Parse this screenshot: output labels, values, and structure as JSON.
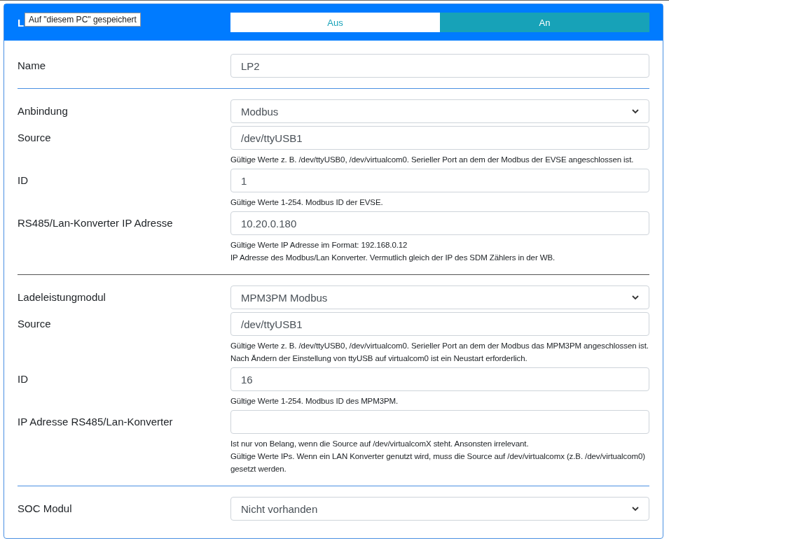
{
  "header": {
    "title": "L",
    "toggle": [
      {
        "label": "Aus",
        "selected": false
      },
      {
        "label": "An",
        "selected": true
      }
    ]
  },
  "tooltip": "Auf \"diesem PC\" gespeichert",
  "rows": [
    {
      "kind": "input",
      "label": "Name",
      "value": "LP2"
    },
    {
      "kind": "divider"
    },
    {
      "kind": "select",
      "label": "Anbindung",
      "value": "Modbus"
    },
    {
      "kind": "input",
      "label": "Source",
      "value": "/dev/ttyUSB1",
      "help": [
        "Gültige Werte z. B. /dev/ttyUSB0, /dev/virtualcom0. Serieller Port an dem der Modbus der EVSE angeschlossen ist."
      ]
    },
    {
      "kind": "input",
      "label": "ID",
      "value": "1",
      "help": [
        "Gültige Werte 1-254. Modbus ID der EVSE."
      ]
    },
    {
      "kind": "input",
      "label": "RS485/Lan-Konverter IP Adresse",
      "value": "10.20.0.180",
      "help": [
        "Gültige Werte IP Adresse im Format: 192.168.0.12",
        "IP Adresse des Modbus/Lan Konverter. Vermutlich gleich der IP des SDM Zählers in der WB."
      ]
    },
    {
      "kind": "separator"
    },
    {
      "kind": "select",
      "label": "Ladeleistungmodul",
      "value": "MPM3PM Modbus"
    },
    {
      "kind": "input",
      "label": "Source",
      "value": "/dev/ttyUSB1",
      "help": [
        "Gültige Werte z. B. /dev/ttyUSB0, /dev/virtualcom0. Serieller Port an dem der Modbus das MPM3PM angeschlossen ist. Nach Ändern der Einstellung von ttyUSB auf virtualcom0 ist ein Neustart erforderlich."
      ]
    },
    {
      "kind": "input",
      "label": "ID",
      "value": "16",
      "help": [
        "Gültige Werte 1-254. Modbus ID des MPM3PM."
      ]
    },
    {
      "kind": "input",
      "label": "IP Adresse RS485/Lan-Konverter",
      "value": "",
      "help": [
        "Ist nur von Belang, wenn die Source auf /dev/virtualcomX steht. Ansonsten irrelevant.",
        "Gültige Werte IPs. Wenn ein LAN Konverter genutzt wird, muss die Source auf /dev/virtualcomx (z.B. /dev/virtualcom0) gesetzt werden."
      ]
    },
    {
      "kind": "divider"
    },
    {
      "kind": "select",
      "label": "SOC Modul",
      "value": "Nicht vorhanden"
    }
  ]
}
